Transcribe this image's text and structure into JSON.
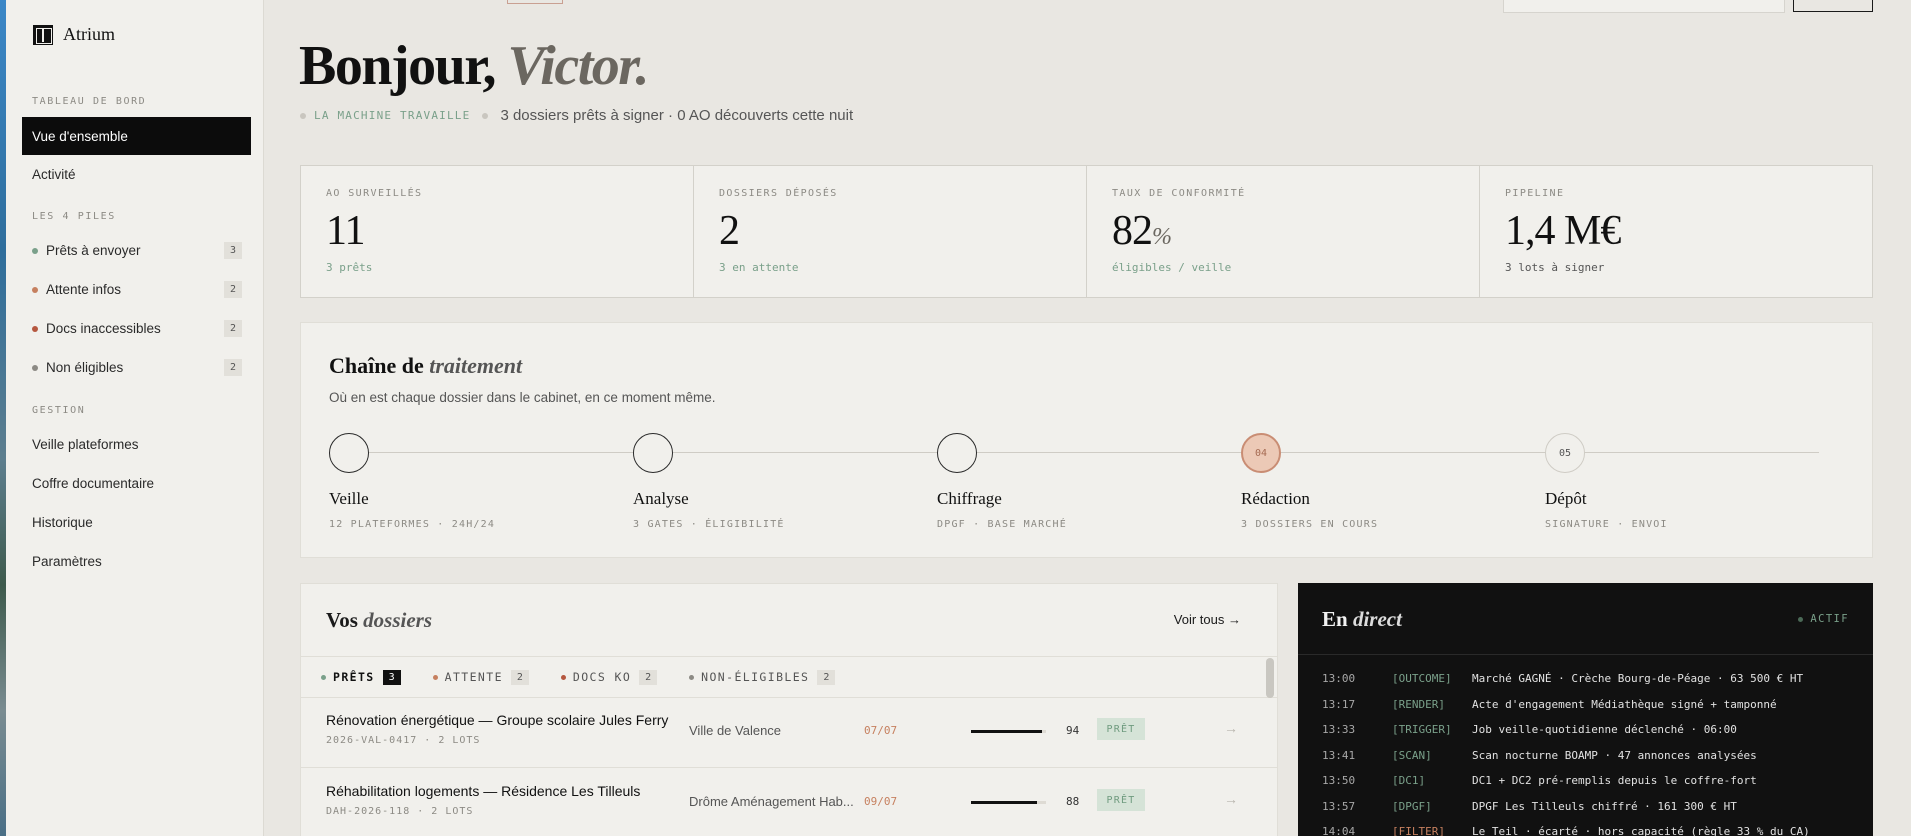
{
  "app": {
    "name": "Atrium"
  },
  "sidebar": {
    "section_dashboard": "TABLEAU DE BORD",
    "nav_overview": "Vue d'ensemble",
    "nav_activity": "Activité",
    "section_piles": "LES 4 PILES",
    "piles": [
      {
        "label": "Prêts à envoyer",
        "count": "3",
        "color": "#7aa08a"
      },
      {
        "label": "Attente infos",
        "count": "2",
        "color": "#c6805f"
      },
      {
        "label": "Docs inaccessibles",
        "count": "2",
        "color": "#b5573f"
      },
      {
        "label": "Non éligibles",
        "count": "2",
        "color": "#8c8a84"
      }
    ],
    "section_gestion": "GESTION",
    "gestion": [
      "Veille plateformes",
      "Coffre documentaire",
      "Historique",
      "Paramètres"
    ]
  },
  "header": {
    "greeting": "Bonjour,",
    "name": "Victor.",
    "machine": "LA MACHINE TRAVAILLE",
    "summary": "3 dossiers prêts à signer · 0 AO découverts cette nuit"
  },
  "kpis": [
    {
      "label": "AO SURVEILLÉS",
      "value": "11",
      "unit": "",
      "sub": "3 prêts"
    },
    {
      "label": "DOSSIERS DÉPOSÉS",
      "value": "2",
      "unit": "",
      "sub": "3 en attente"
    },
    {
      "label": "TAUX DE CONFORMITÉ",
      "value": "82",
      "unit": "%",
      "sub": "éligibles / veille"
    },
    {
      "label": "PIPELINE",
      "value": "1,4 M€",
      "unit": "",
      "sub": "3 lots à signer"
    }
  ],
  "chain": {
    "title_a": "Chaîne de",
    "title_b": "traitement",
    "subtitle": "Où en est chaque dossier dans le cabinet, en ce moment même.",
    "steps": [
      {
        "num": "",
        "name": "Veille",
        "desc": "12 PLATEFORMES · 24H/24",
        "state": "done"
      },
      {
        "num": "",
        "name": "Analyse",
        "desc": "3 GATES · ÉLIGIBILITÉ",
        "state": "done"
      },
      {
        "num": "",
        "name": "Chiffrage",
        "desc": "DPGF · BASE MARCHÉ",
        "state": "done"
      },
      {
        "num": "04",
        "name": "Rédaction",
        "desc": "3 DOSSIERS EN COURS",
        "state": "active"
      },
      {
        "num": "05",
        "name": "Dépôt",
        "desc": "SIGNATURE · ENVOI",
        "state": "future"
      }
    ]
  },
  "dossiers": {
    "title_a": "Vos",
    "title_b": "dossiers",
    "see_all": "Voir tous →",
    "tabs": [
      {
        "label": "PRÊTS",
        "count": "3",
        "color": "#7aa08a"
      },
      {
        "label": "ATTENTE",
        "count": "2",
        "color": "#c6805f"
      },
      {
        "label": "DOCS KO",
        "count": "2",
        "color": "#b5573f"
      },
      {
        "label": "NON-ÉLIGIBLES",
        "count": "2",
        "color": "#8c8a84"
      }
    ],
    "rows": [
      {
        "title": "Rénovation énergétique — Groupe scolaire Jules Ferry",
        "ref": "2026-VAL-0417 · 2 LOTS",
        "buyer": "Ville de Valence",
        "date": "07/07",
        "score": 94,
        "status": "PRÊT"
      },
      {
        "title": "Réhabilitation logements — Résidence Les Tilleuls",
        "ref": "DAH-2026-118 · 2 LOTS",
        "buyer": "Drôme Aménagement Hab...",
        "date": "09/07",
        "score": 88,
        "status": "PRÊT"
      }
    ]
  },
  "live": {
    "title_a": "En",
    "title_b": "direct",
    "status": "ACTIF",
    "logs": [
      {
        "time": "13:00",
        "tag": "[OUTCOME]",
        "msg": "Marché GAGNÉ · Crèche Bourg-de-Péage · 63 500 € HT",
        "color": "#7aa08a"
      },
      {
        "time": "13:17",
        "tag": "[RENDER]",
        "msg": "Acte d'engagement Médiathèque signé + tamponné",
        "color": "#7aa08a"
      },
      {
        "time": "13:33",
        "tag": "[TRIGGER]",
        "msg": "Job veille-quotidienne déclenché · 06:00",
        "color": "#7aa08a"
      },
      {
        "time": "13:41",
        "tag": "[SCAN]",
        "msg": "Scan nocturne BOAMP · 47 annonces analysées",
        "color": "#7aa08a"
      },
      {
        "time": "13:50",
        "tag": "[DC1]",
        "msg": "DC1 + DC2 pré-remplis depuis le coffre-fort",
        "color": "#7aa08a"
      },
      {
        "time": "13:57",
        "tag": "[DPGF]",
        "msg": "DPGF Les Tilleuls chiffré · 161 300 € HT",
        "color": "#7aa08a"
      },
      {
        "time": "14:04",
        "tag": "[FILTER]",
        "msg": "Le Teil · écarté · hors capacité (règle 33 % du CA)",
        "color": "#c6805f"
      }
    ]
  }
}
